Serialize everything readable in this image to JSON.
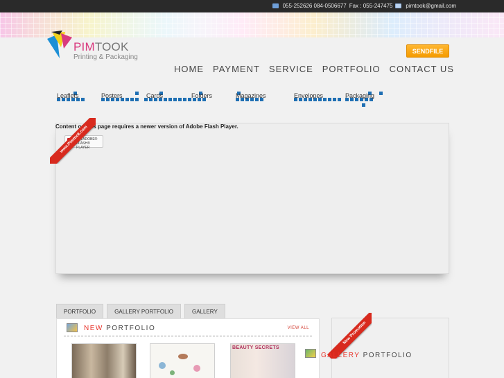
{
  "topbar": {
    "phones": "055-252626 084-0506677",
    "fax": "Fax : 055-247475",
    "email": "pimtook@gmail.com"
  },
  "brand": {
    "name_accent": "PIM",
    "name_rest": "TOOK",
    "tagline": "Printing & Packaging",
    "accent_color": "#d93a7e"
  },
  "header": {
    "sendfile_label": "SENDFILE"
  },
  "main_nav": [
    "HOME",
    "PAYMENT",
    "SERVICE",
    "PORTFOLIO",
    "CONTACT US"
  ],
  "sub_nav": [
    "Leaflets",
    "Posters",
    "Cards",
    "Folders",
    "Magazines",
    "Envelopes",
    "Packaging"
  ],
  "flash": {
    "message": "Content on this page requires a newer version of Adobe Flash Player.",
    "badge_line1": "Get ADOBE®",
    "badge_line2": "FLASH® PLAYER",
    "ribbon": "www.Pimtook.com"
  },
  "tabs": [
    "PORTFOLIO",
    "GALLERY PORTFOLIO",
    "GALLERY"
  ],
  "portfolio": {
    "title_accent": "NEW",
    "title_rest": "PORTFOLIO",
    "view_all": "VIEW ALL",
    "thumb3_caption": "BEAUTY SECRETS"
  },
  "gallery": {
    "ribbon": "New Promotion",
    "title_accent": "GALLERY",
    "title_rest": "PORTFOLIO"
  }
}
